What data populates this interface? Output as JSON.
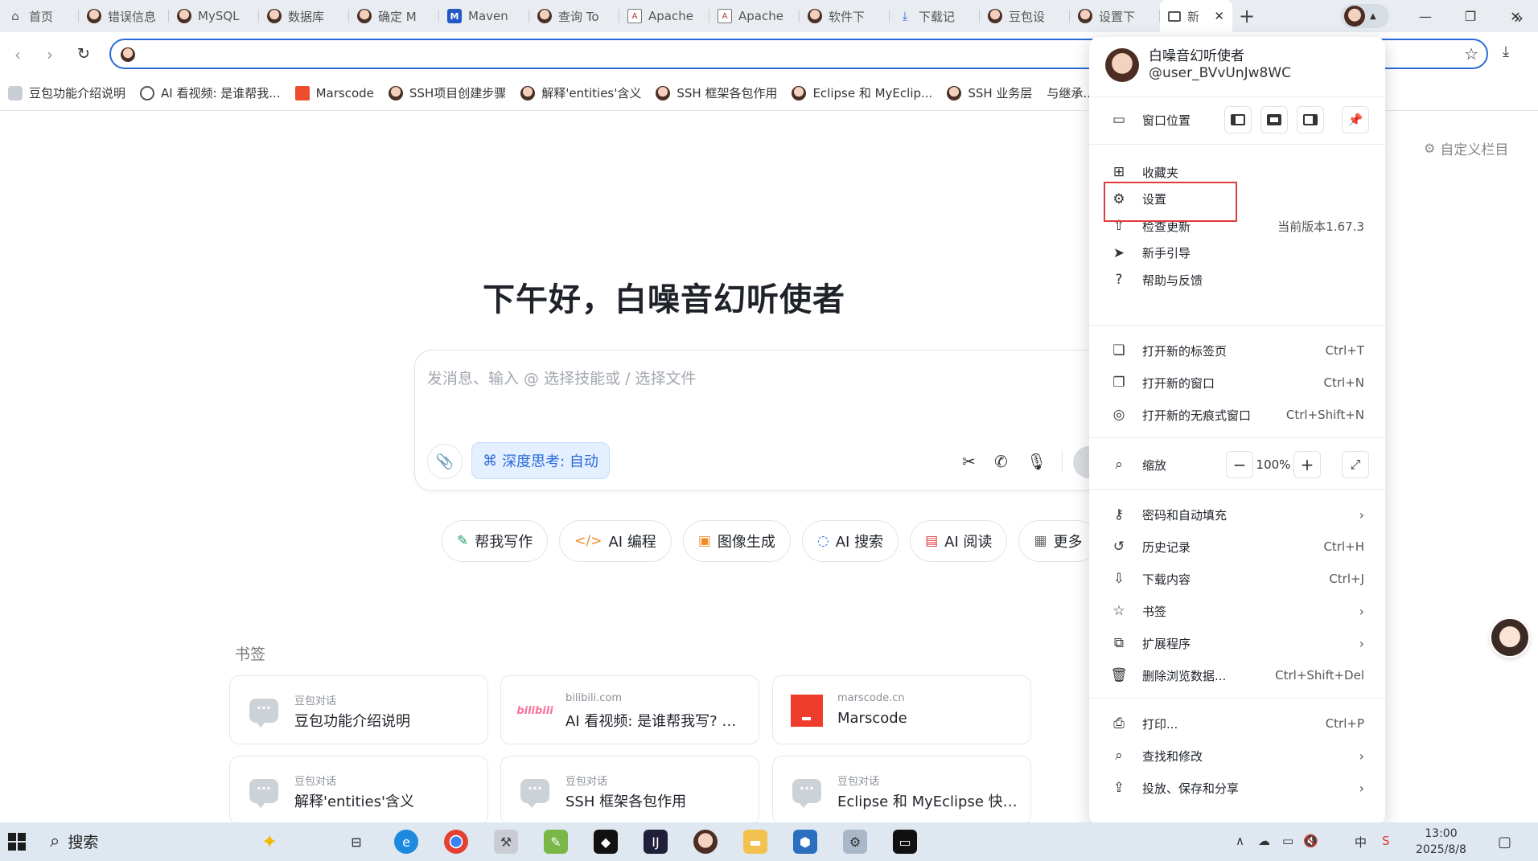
{
  "tabs": [
    {
      "label": "首页",
      "icon": "home-icon"
    },
    {
      "label": "错误信息",
      "icon": "avatar-favicon-icon"
    },
    {
      "label": "MySQL",
      "icon": "avatar-favicon-icon"
    },
    {
      "label": "数据库",
      "icon": "avatar-favicon-icon"
    },
    {
      "label": "确定 M",
      "icon": "avatar-favicon-icon"
    },
    {
      "label": "Maven",
      "icon": "maven-icon"
    },
    {
      "label": "查询 To",
      "icon": "avatar-favicon-icon"
    },
    {
      "label": "Apache",
      "icon": "apache-icon"
    },
    {
      "label": "Apache",
      "icon": "apache-icon"
    },
    {
      "label": "软件下",
      "icon": "avatar-favicon-icon"
    },
    {
      "label": "下载记",
      "icon": "download-icon"
    },
    {
      "label": "豆包设",
      "icon": "avatar-favicon-icon"
    },
    {
      "label": "设置下",
      "icon": "avatar-favicon-icon"
    }
  ],
  "active_tab": {
    "label": "新",
    "close": "✕"
  },
  "new_tab": "+",
  "window_controls": {
    "minimize": "—",
    "maximize": "❐",
    "close": "✕"
  },
  "bookmarks_bar": [
    {
      "label": "豆包功能介绍说明",
      "icon": "chat-icon"
    },
    {
      "label": "AI 看视频: 是谁帮我...",
      "icon": "globe-icon"
    },
    {
      "label": "Marscode",
      "icon": "marscode-icon"
    },
    {
      "label": "SSH项目创建步骤",
      "icon": "avatar-favicon-icon"
    },
    {
      "label": "解释'entities'含义",
      "icon": "avatar-favicon-icon"
    },
    {
      "label": "SSH 框架各包作用",
      "icon": "avatar-favicon-icon"
    },
    {
      "label": "Eclipse 和 MyEclip...",
      "icon": "avatar-favicon-icon"
    },
    {
      "label": "SSH 业务层",
      "icon": "avatar-favicon-icon"
    },
    {
      "label": "与继承...",
      "icon": "none"
    }
  ],
  "bookmarks_more": "»",
  "customize_label": "自定义栏目",
  "greeting": "下午好，白噪音幻听使者",
  "composer": {
    "placeholder": "发消息、输入 @ 选择技能或 / 选择文件",
    "deep_think_label": "深度思考: 自动"
  },
  "skills": [
    {
      "label": "帮我写作",
      "icon": "pen-icon",
      "color": "#22a06b",
      "glyph": "✎"
    },
    {
      "label": "AI 编程",
      "icon": "code-icon",
      "color": "#f08a24",
      "glyph": "</>"
    },
    {
      "label": "图像生成",
      "icon": "image-icon",
      "color": "#f08a24",
      "glyph": "▣"
    },
    {
      "label": "AI 搜索",
      "icon": "search-icon",
      "color": "#2a6bd8",
      "glyph": "◌"
    },
    {
      "label": "AI 阅读",
      "icon": "read-icon",
      "color": "#e03a3a",
      "glyph": "▤"
    },
    {
      "label": "更多",
      "icon": "grid-icon",
      "color": "#666666",
      "glyph": "▦"
    }
  ],
  "bookmarks_section": {
    "title": "书签",
    "cards": [
      {
        "source": "豆包对话",
        "title": "豆包功能介绍说明",
        "type": "chat"
      },
      {
        "source": "bilibili.com",
        "title": "AI 看视频: 是谁帮我写? 作...",
        "type": "bilibili",
        "logo_text": "bilibili"
      },
      {
        "source": "marscode.cn",
        "title": "Marscode",
        "type": "marscode"
      },
      {
        "source": "豆包对话",
        "title": "解释'entities'含义",
        "type": "chat"
      },
      {
        "source": "豆包对话",
        "title": "SSH 框架各包作用",
        "type": "chat"
      },
      {
        "source": "豆包对话",
        "title": "Eclipse 和 MyEclipse 快捷...",
        "type": "chat"
      }
    ]
  },
  "menu": {
    "user_name": "白噪音幻听使者",
    "user_id": "@user_BVvUnJw8WC",
    "window_position_label": "窗口位置",
    "items_a": [
      {
        "label": "收藏夹",
        "icon": "bookmark-add-icon",
        "glyph": "⊞"
      },
      {
        "label": "设置",
        "icon": "gear-icon",
        "glyph": "⚙"
      },
      {
        "label": "检查更新",
        "icon": "update-icon",
        "glyph": "⇧",
        "extra": "当前版本1.67.3"
      },
      {
        "label": "新手引导",
        "icon": "navigation-icon",
        "glyph": "➤"
      },
      {
        "label": "帮助与反馈",
        "icon": "help-icon",
        "glyph": "?"
      }
    ],
    "items_b": [
      {
        "label": "打开新的标签页",
        "icon": "new-tab-icon",
        "glyph": "❏",
        "shortcut": "Ctrl+T"
      },
      {
        "label": "打开新的窗口",
        "icon": "new-window-icon",
        "glyph": "❐",
        "shortcut": "Ctrl+N"
      },
      {
        "label": "打开新的无痕式窗口",
        "icon": "incognito-icon",
        "glyph": "◎",
        "shortcut": "Ctrl+Shift+N"
      }
    ],
    "zoom": {
      "label": "缩放",
      "value": "100%",
      "minus": "−",
      "plus": "+"
    },
    "items_c": [
      {
        "label": "密码和自动填充",
        "icon": "key-icon",
        "glyph": "⚷",
        "arrow": "›"
      },
      {
        "label": "历史记录",
        "icon": "history-icon",
        "glyph": "↺",
        "shortcut": "Ctrl+H"
      },
      {
        "label": "下载内容",
        "icon": "download-tray-icon",
        "glyph": "⇩",
        "shortcut": "Ctrl+J"
      },
      {
        "label": "书签",
        "icon": "star-icon",
        "glyph": "☆",
        "arrow": "›"
      },
      {
        "label": "扩展程序",
        "icon": "extension-icon",
        "glyph": "⧉",
        "arrow": "›"
      },
      {
        "label": "删除浏览数据...",
        "icon": "trash-icon",
        "glyph": "🗑",
        "shortcut": "Ctrl+Shift+Del"
      }
    ],
    "items_d": [
      {
        "label": "打印...",
        "icon": "print-icon",
        "glyph": "⎙",
        "shortcut": "Ctrl+P"
      },
      {
        "label": "查找和修改",
        "icon": "find-icon",
        "glyph": "⌕",
        "arrow": "›"
      },
      {
        "label": "投放、保存和分享",
        "icon": "share-icon",
        "glyph": "⇪",
        "arrow": "›"
      }
    ]
  },
  "taskbar": {
    "search_label": "搜索",
    "time": "13:00",
    "date": "2025/8/8",
    "ime": "中"
  }
}
